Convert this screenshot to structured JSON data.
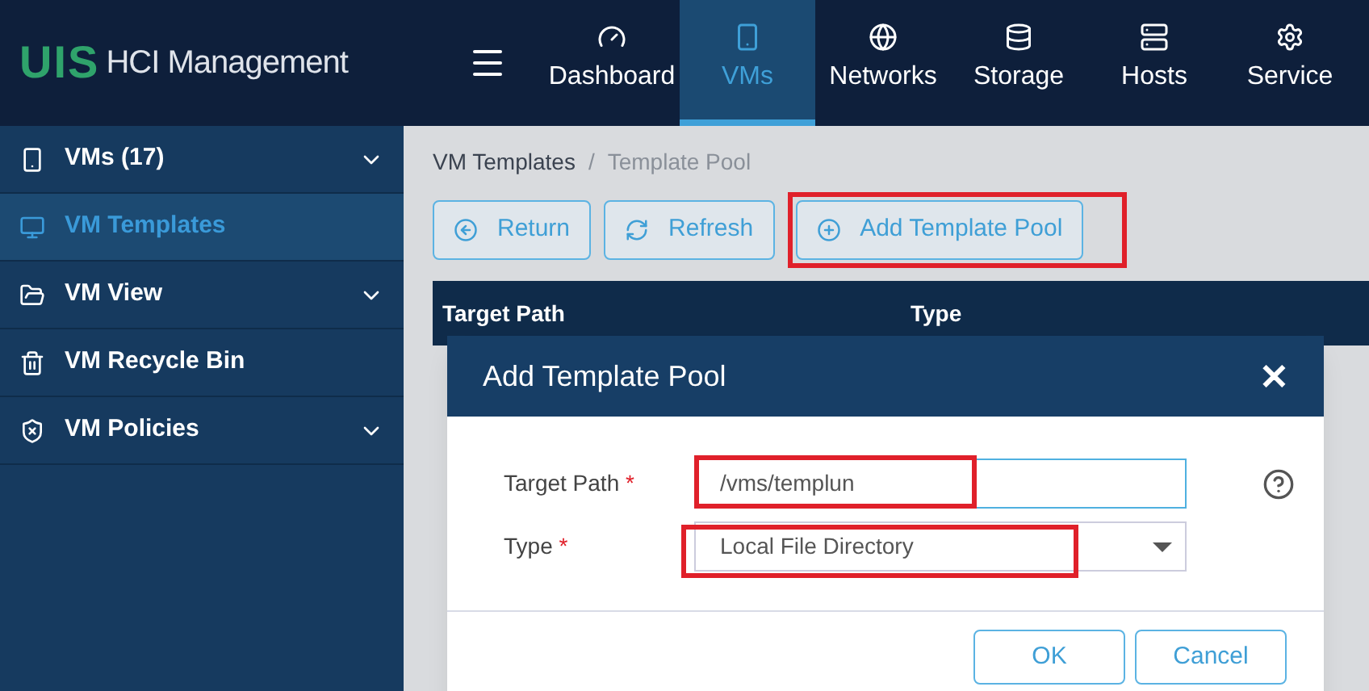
{
  "header": {
    "logo": "UIS",
    "title": "HCI Management",
    "nav": [
      {
        "label": "Dashboard",
        "selected": false
      },
      {
        "label": "VMs",
        "selected": true
      },
      {
        "label": "Networks",
        "selected": false
      },
      {
        "label": "Storage",
        "selected": false
      },
      {
        "label": "Hosts",
        "selected": false
      },
      {
        "label": "Service",
        "selected": false
      }
    ]
  },
  "sidebar": {
    "items": [
      {
        "label": "VMs (17)",
        "selected": false,
        "expandable": true
      },
      {
        "label": "VM Templates",
        "selected": true,
        "expandable": false
      },
      {
        "label": "VM View",
        "selected": false,
        "expandable": true
      },
      {
        "label": "VM Recycle Bin",
        "selected": false,
        "expandable": false
      },
      {
        "label": "VM Policies",
        "selected": false,
        "expandable": true
      }
    ]
  },
  "breadcrumb": [
    "VM Templates",
    "/",
    "Template Pool"
  ],
  "toolbar": [
    {
      "label": "Return",
      "highlighted": false
    },
    {
      "label": "Refresh",
      "highlighted": false
    },
    {
      "label": "Add Template Pool",
      "highlighted": true
    }
  ],
  "table": {
    "columns": [
      "Target Path",
      "Type"
    ]
  },
  "dialog": {
    "title": "Add Template Pool",
    "close": "✕",
    "fields": [
      {
        "kind": "text",
        "label": "Target Path",
        "required_mark": "*",
        "value": "/vms/templun",
        "highlighted": true,
        "help": true
      },
      {
        "kind": "select",
        "label": "Type",
        "required_mark": "*",
        "value": "Local File Directory",
        "highlighted": true,
        "help": false
      }
    ],
    "buttons": [
      "OK",
      "Cancel"
    ]
  }
}
